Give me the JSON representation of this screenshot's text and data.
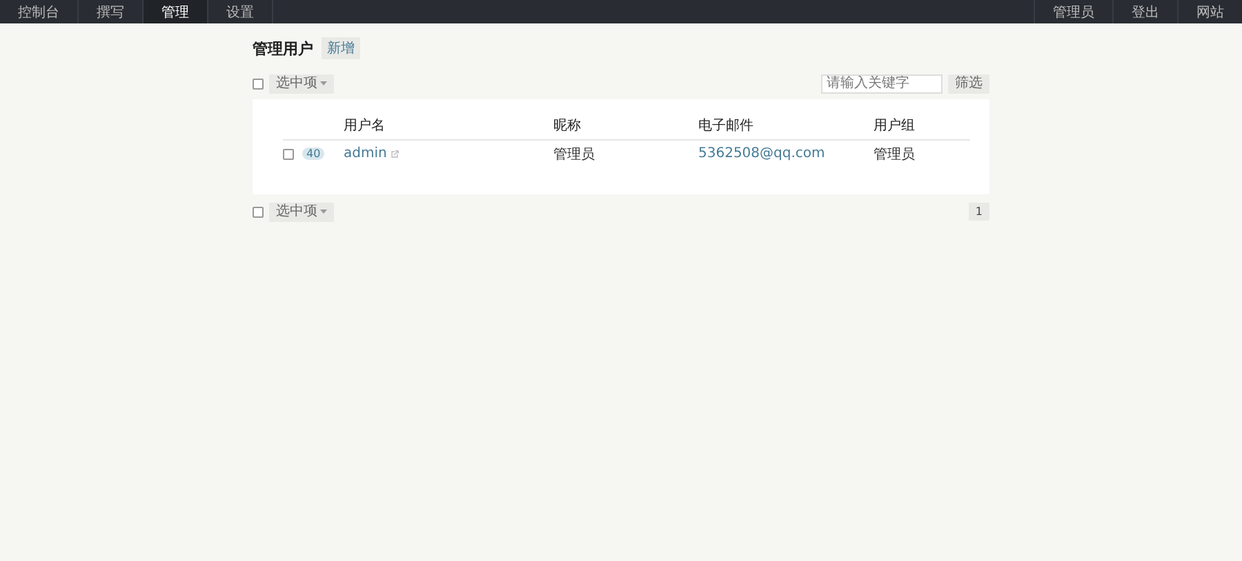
{
  "nav": {
    "left": [
      {
        "label": "控制台",
        "selected": false
      },
      {
        "label": "撰写",
        "selected": false
      },
      {
        "label": "管理",
        "selected": true
      },
      {
        "label": "设置",
        "selected": false
      }
    ],
    "right": [
      "管理员",
      "登出",
      "网站"
    ]
  },
  "page": {
    "title": "管理用户",
    "add_button": "新增"
  },
  "toolbar": {
    "select_all": {
      "checked": false
    },
    "action": "选中项",
    "search": {
      "placeholder": "请输入关键字"
    },
    "filter_button": "筛选"
  },
  "table": {
    "columns": [
      "用户名",
      "昵称",
      "电子邮件",
      "用户组"
    ],
    "rows": [
      {
        "checked": false,
        "posts": "40",
        "username": "admin",
        "nickname": "管理员",
        "email": "5362508@qq.com",
        "group": "管理员"
      }
    ]
  },
  "footer": {
    "select_all": {
      "checked": false
    },
    "action": "选中项",
    "pages": [
      {
        "label": "1",
        "selected": true
      }
    ]
  }
}
